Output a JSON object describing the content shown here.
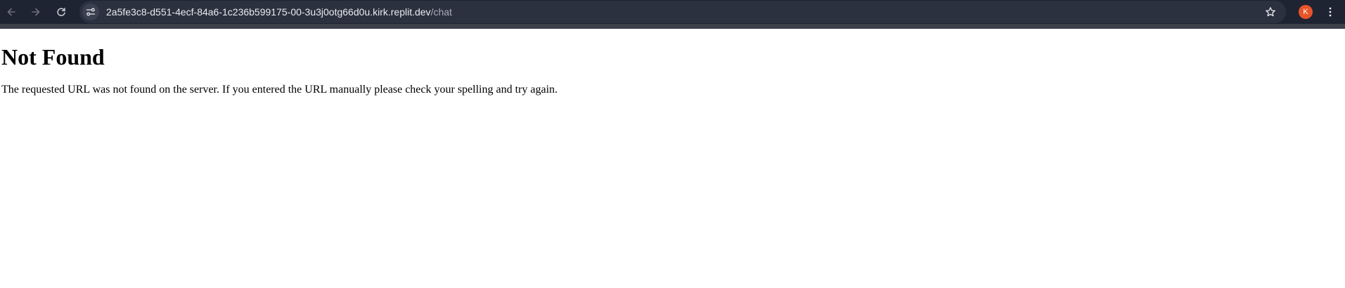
{
  "browser": {
    "url_host": "2a5fe3c8-d551-4ecf-84a6-1c236b599175-00-3u3j0otg66d0u.kirk.replit.dev",
    "url_path": "/chat",
    "profile_initial": "K",
    "colors": {
      "toolbar_bg": "#1f2433",
      "omnibox_bg": "#2c3140",
      "avatar_bg": "#e8542a"
    },
    "icons": [
      "back-arrow-icon",
      "forward-arrow-icon",
      "reload-icon",
      "site-info-icon",
      "star-icon",
      "kebab-menu-icon"
    ]
  },
  "page": {
    "heading": "Not Found",
    "message": "The requested URL was not found on the server. If you entered the URL manually please check your spelling and try again."
  }
}
